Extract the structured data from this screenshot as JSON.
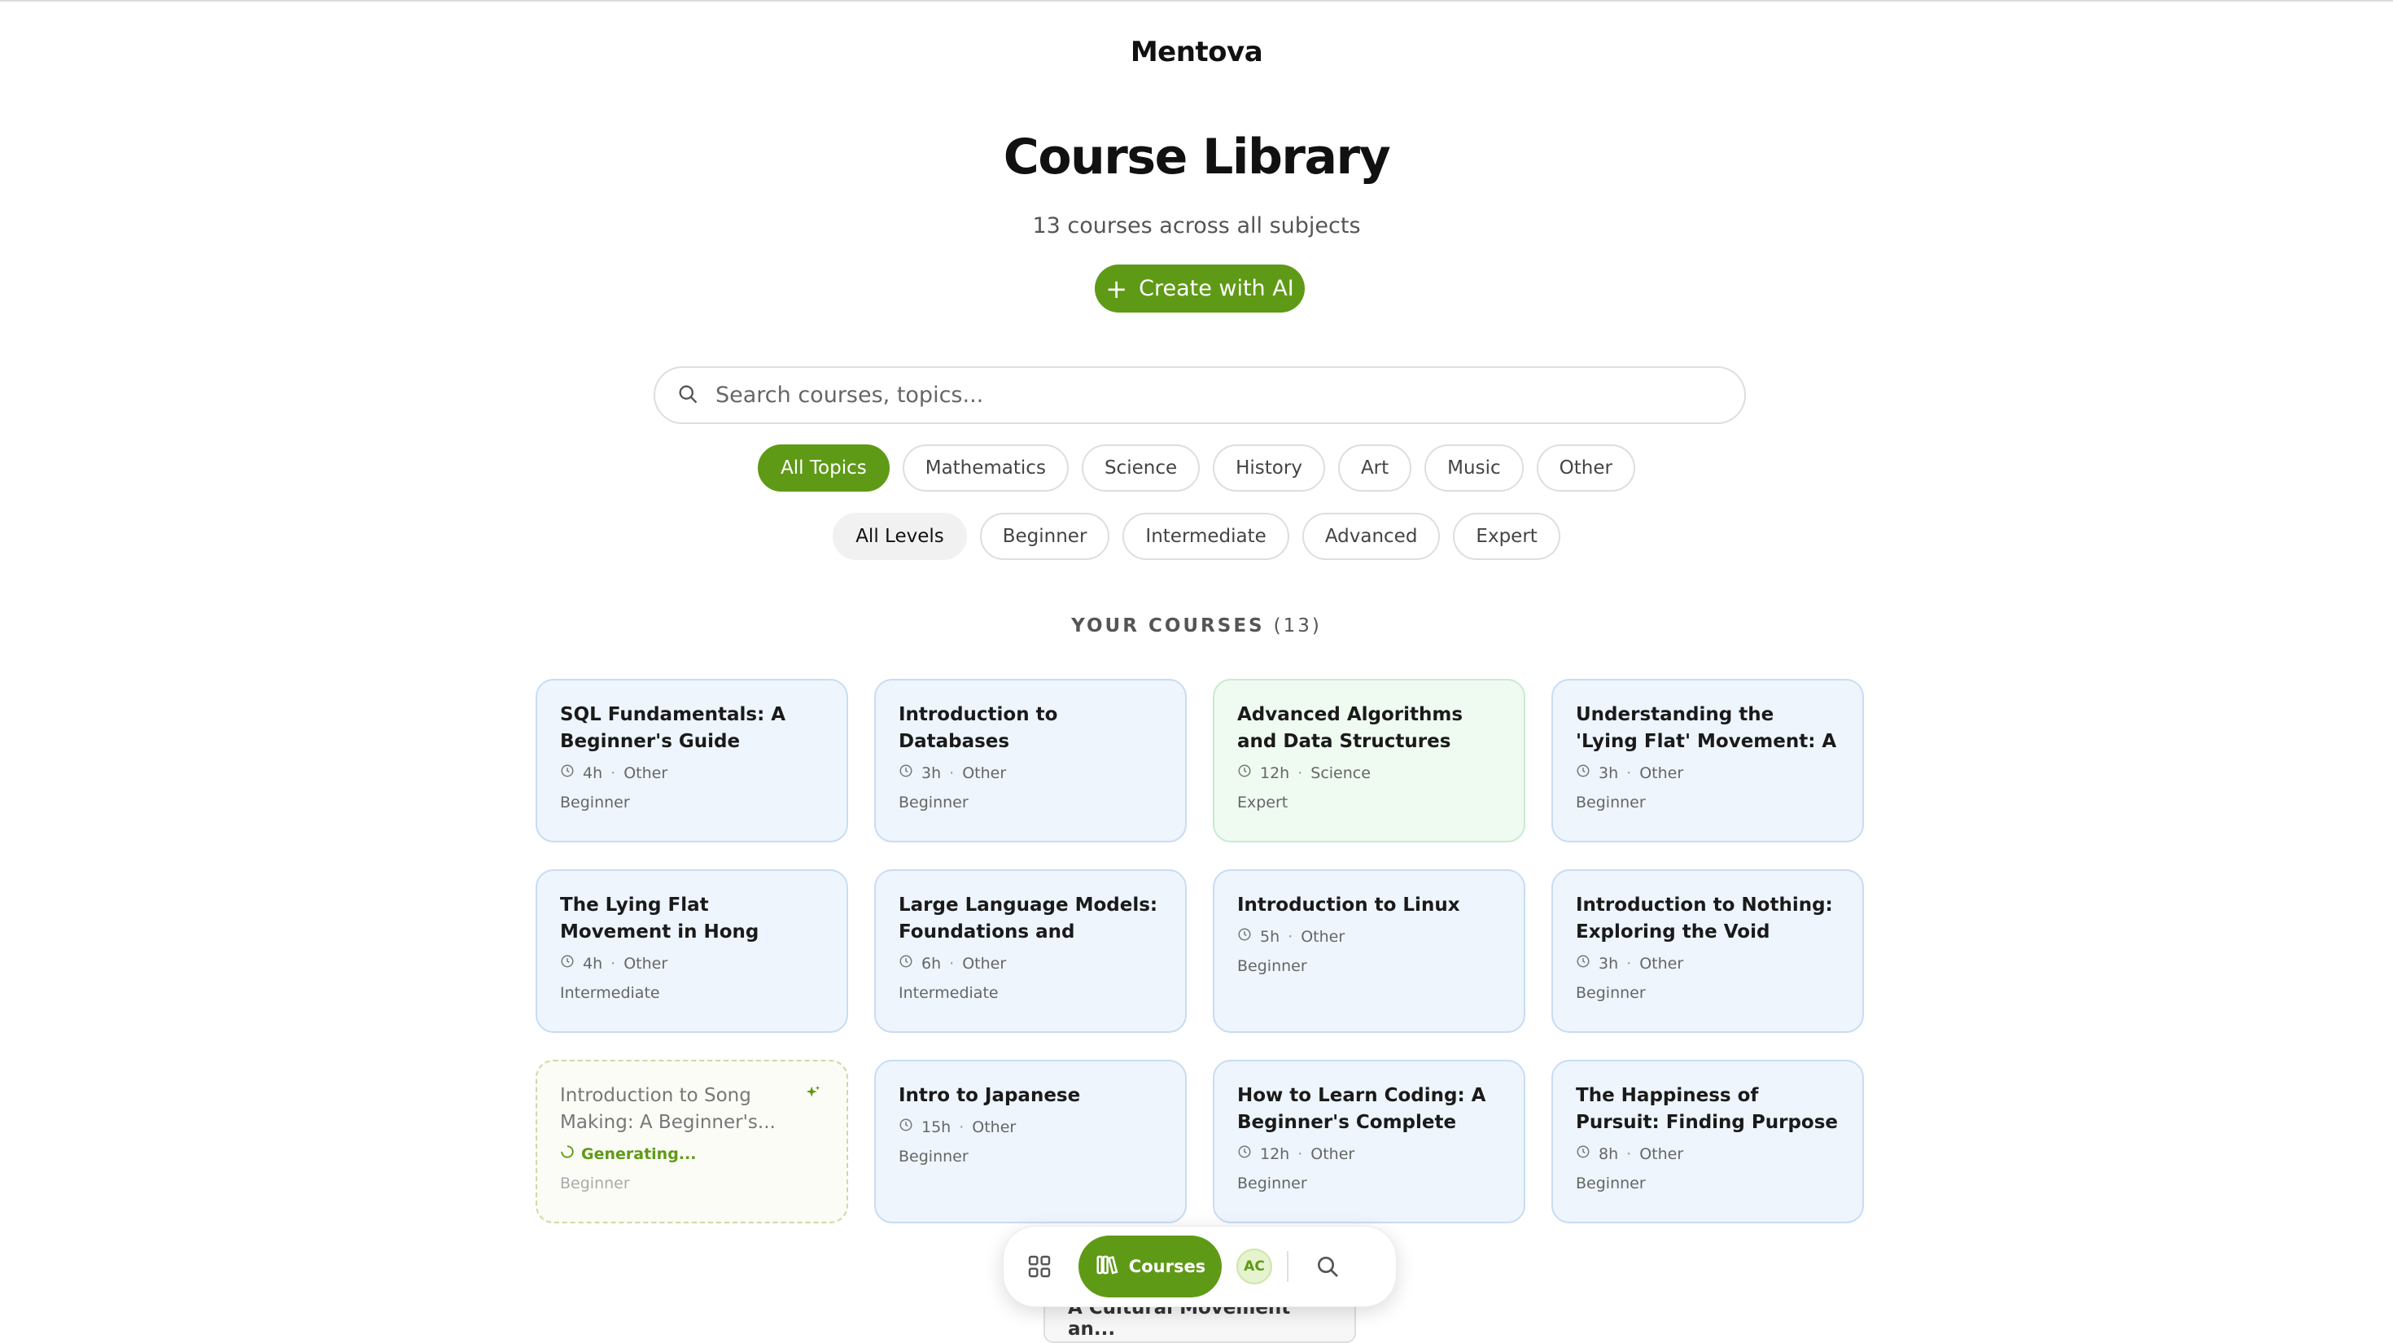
{
  "brand": "Mentova",
  "header": {
    "title": "Course Library",
    "subtitle": "13 courses across all subjects",
    "create_label": "Create with AI"
  },
  "search": {
    "placeholder": "Search courses, topics...",
    "value": ""
  },
  "topics": [
    "All Topics",
    "Mathematics",
    "Science",
    "History",
    "Art",
    "Music",
    "Other"
  ],
  "levels": [
    "All Levels",
    "Beginner",
    "Intermediate",
    "Advanced",
    "Expert"
  ],
  "section": {
    "label": "YOUR COURSES",
    "count": "(13)"
  },
  "colors": {
    "accent": "#5f9a16",
    "card_blue": "#eef5fd",
    "card_green": "#effaf1"
  },
  "courses": [
    {
      "title": "SQL Fundamentals: A Beginner's Guide",
      "duration": "4h",
      "category": "Other",
      "level": "Beginner"
    },
    {
      "title": "Introduction to Databases",
      "duration": "3h",
      "category": "Other",
      "level": "Beginner"
    },
    {
      "title": "Advanced Algorithms and Data Structures",
      "duration": "12h",
      "category": "Science",
      "level": "Expert"
    },
    {
      "title": "Understanding the 'Lying Flat' Movement: A Social...",
      "duration": "3h",
      "category": "Other",
      "level": "Beginner"
    },
    {
      "title": "The Lying Flat Movement in Hong Kong: Finding Balance...",
      "duration": "4h",
      "category": "Other",
      "level": "Intermediate"
    },
    {
      "title": "Large Language Models: Foundations and Applications",
      "duration": "6h",
      "category": "Other",
      "level": "Intermediate"
    },
    {
      "title": "Introduction to Linux",
      "duration": "5h",
      "category": "Other",
      "level": "Beginner"
    },
    {
      "title": "Introduction to Nothing: Exploring the Void",
      "duration": "3h",
      "category": "Other",
      "level": "Beginner"
    },
    {
      "title": "Introduction to Song Making: A Beginner's...",
      "status": "Generating...",
      "level": "Beginner"
    },
    {
      "title": "Intro to Japanese",
      "duration": "15h",
      "category": "Other",
      "level": "Beginner"
    },
    {
      "title": "How to Learn Coding: A Beginner's Complete Guide",
      "duration": "12h",
      "category": "Other",
      "level": "Beginner"
    },
    {
      "title": "The Happiness of Pursuit: Finding Purpose Through...",
      "duration": "8h",
      "category": "Other",
      "level": "Beginner"
    }
  ],
  "peek_card_title": "A Cultural Movement an...",
  "bottom_nav": {
    "courses_label": "Courses",
    "avatar_initials": "AC",
    "icons": [
      "grid-icon",
      "books-icon",
      "search-icon"
    ]
  }
}
